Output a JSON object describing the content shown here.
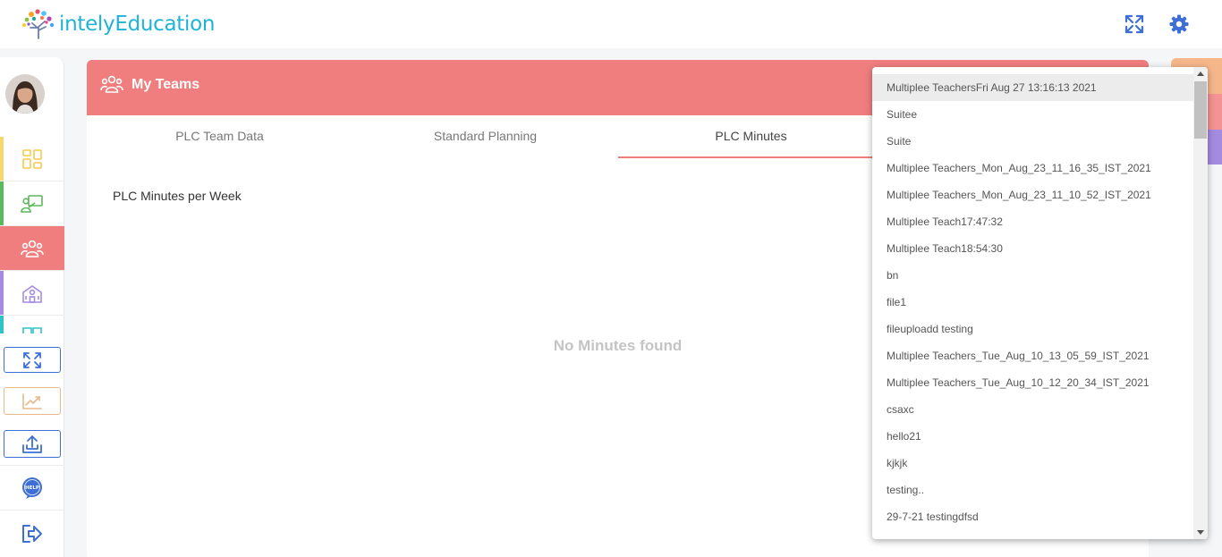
{
  "app": {
    "brand_name": "intelyEducation"
  },
  "topbar": {
    "fullscreen_icon": "expand-arrows-icon",
    "settings_icon": "gear-icon"
  },
  "sidebar": {
    "items": [
      {
        "name": "dashboard",
        "icon": "grid-icon",
        "color": "#f5d76e"
      },
      {
        "name": "classroom",
        "icon": "teacher-board-icon",
        "color": "#5cb85c"
      },
      {
        "name": "teams",
        "icon": "users-icon",
        "color": "#f07e7e"
      },
      {
        "name": "school",
        "icon": "school-building-icon",
        "color": "#a48be0"
      }
    ],
    "tools": [
      {
        "name": "fullscreen",
        "icon": "expand-arrows-icon",
        "color": "#3d6fd6"
      },
      {
        "name": "analytics",
        "icon": "line-chart-icon",
        "color": "#e8b98a"
      },
      {
        "name": "upload",
        "icon": "upload-icon",
        "color": "#3d6fd6"
      }
    ],
    "help_icon": "help-bubble-icon",
    "logout_icon": "logout-icon",
    "help_badge": "HELP"
  },
  "card": {
    "title": "My Teams",
    "tabs": [
      "PLC Team Data",
      "Standard Planning",
      "PLC Minutes"
    ],
    "active_tab": "PLC Minutes",
    "section_title": "PLC Minutes per Week",
    "empty_message": "No Minutes found"
  },
  "dropdown": {
    "selected": "Multiplee TeachersFri Aug 27 13:16:13 2021",
    "options": [
      "Multiplee TeachersFri Aug 27 13:16:13 2021",
      "Suitee",
      "Suite",
      "Multiplee Teachers_Mon_Aug_23_11_16_35_IST_2021",
      "Multiplee Teachers_Mon_Aug_23_11_10_52_IST_2021",
      "Multiplee Teach17:47:32",
      "Multiplee Teach18:54:30",
      "bn",
      "file1",
      "fileuploadd testing",
      "Multiplee Teachers_Tue_Aug_10_13_05_59_IST_2021",
      "Multiplee Teachers_Tue_Aug_10_12_20_34_IST_2021",
      "csaxc",
      "hello21",
      "kjkjk",
      "testing..",
      "29-7-21 testingdfsd"
    ]
  },
  "colors": {
    "accent": "#f07e7e",
    "brand": "#1fb3d8",
    "icon_blue": "#3d6fd6"
  }
}
